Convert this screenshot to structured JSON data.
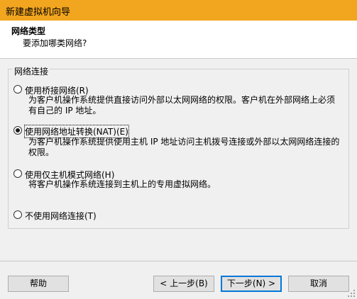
{
  "window": {
    "title": "新建虚拟机向导"
  },
  "header": {
    "title": "网络类型",
    "subtitle": "要添加哪类网络?"
  },
  "group": {
    "legend": "网络连接"
  },
  "options": [
    {
      "label": "使用桥接网络(R)",
      "description": "为客户机操作系统提供直接访问外部以太网网络的权限。客户机在外部网络上必须有自己的 IP 地址。",
      "checked": false
    },
    {
      "label": "使用网络地址转换(NAT)(E)",
      "description": "为客户机操作系统提供使用主机 IP 地址访问主机拨号连接或外部以太网网络连接的权限。",
      "checked": true
    },
    {
      "label": "使用仅主机模式网络(H)",
      "description": "将客户机操作系统连接到主机上的专用虚拟网络。",
      "checked": false
    },
    {
      "label": "不使用网络连接(T)",
      "description": "",
      "checked": false
    }
  ],
  "buttons": {
    "help": "帮助",
    "back": "< 上一步(B)",
    "next": "下一步(N) >",
    "cancel": "取消"
  }
}
